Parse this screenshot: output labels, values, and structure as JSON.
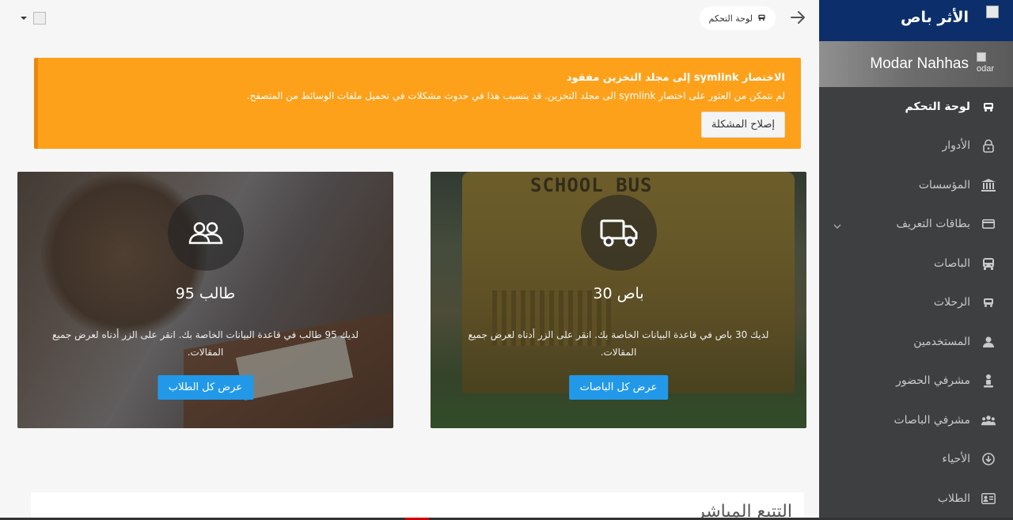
{
  "sidebar": {
    "brand": "الأثر باص",
    "user_name": "Modar Nahhas",
    "avatar_alt": "odar",
    "items": [
      {
        "label": "لوحة التحكم",
        "icon": "dashboard-icon",
        "active": true
      },
      {
        "label": "الأدوار",
        "icon": "lock-icon",
        "active": false
      },
      {
        "label": "المؤسسات",
        "icon": "institution-icon",
        "active": false
      },
      {
        "label": "بطاقات التعريف",
        "icon": "id-card-icon",
        "active": false,
        "has_submenu": true
      },
      {
        "label": "الباصات",
        "icon": "bus-icon",
        "active": false
      },
      {
        "label": "الرحلات",
        "icon": "trips-icon",
        "active": false
      },
      {
        "label": "المستخدمين",
        "icon": "user-icon",
        "active": false
      },
      {
        "label": "مشرفي الحضور",
        "icon": "attendance-supervisor-icon",
        "active": false
      },
      {
        "label": "مشرفي الباصات",
        "icon": "bus-supervisors-icon",
        "active": false
      },
      {
        "label": "الأحياء",
        "icon": "neighborhood-icon",
        "active": false
      },
      {
        "label": "الطلاب",
        "icon": "students-card-icon",
        "active": false
      }
    ]
  },
  "topbar": {
    "breadcrumb": "لوحة التحكم"
  },
  "alert": {
    "title": "الاختصار symlink إلى مجلد التخزين مفقود",
    "message": "لم نتمكن من العثور على اختصار symlink الى مجلد التخزين. قد يتسبب هذا في حدوث مشكلات في تحميل ملفات الوسائط من المتصفح.",
    "button": "إصلاح المشكلة",
    "color": "#fda11b"
  },
  "cards": {
    "buses": {
      "count": "30 باص",
      "description": "لديك 30 باص في قاعدة البيانات الخاصة بك. انقر على الزر أدناه لعرض جميع المقالات.",
      "button": "عرض كل الباصات",
      "image_text": "SCHOOL BUS"
    },
    "students": {
      "count": "95 طالب",
      "description": "لديك 95 طالب في قاعدة البيانات الخاصة بك. انقر على الزر أدناه لعرض جميع المقالات.",
      "button": "عرض كل الطلاب"
    }
  },
  "bottom_panel": {
    "title": "التتبع المباشر"
  },
  "colors": {
    "sidebar_bg": "#3d3f41",
    "brand_bg": "#0c2f6b",
    "button_blue": "#2199e8"
  }
}
